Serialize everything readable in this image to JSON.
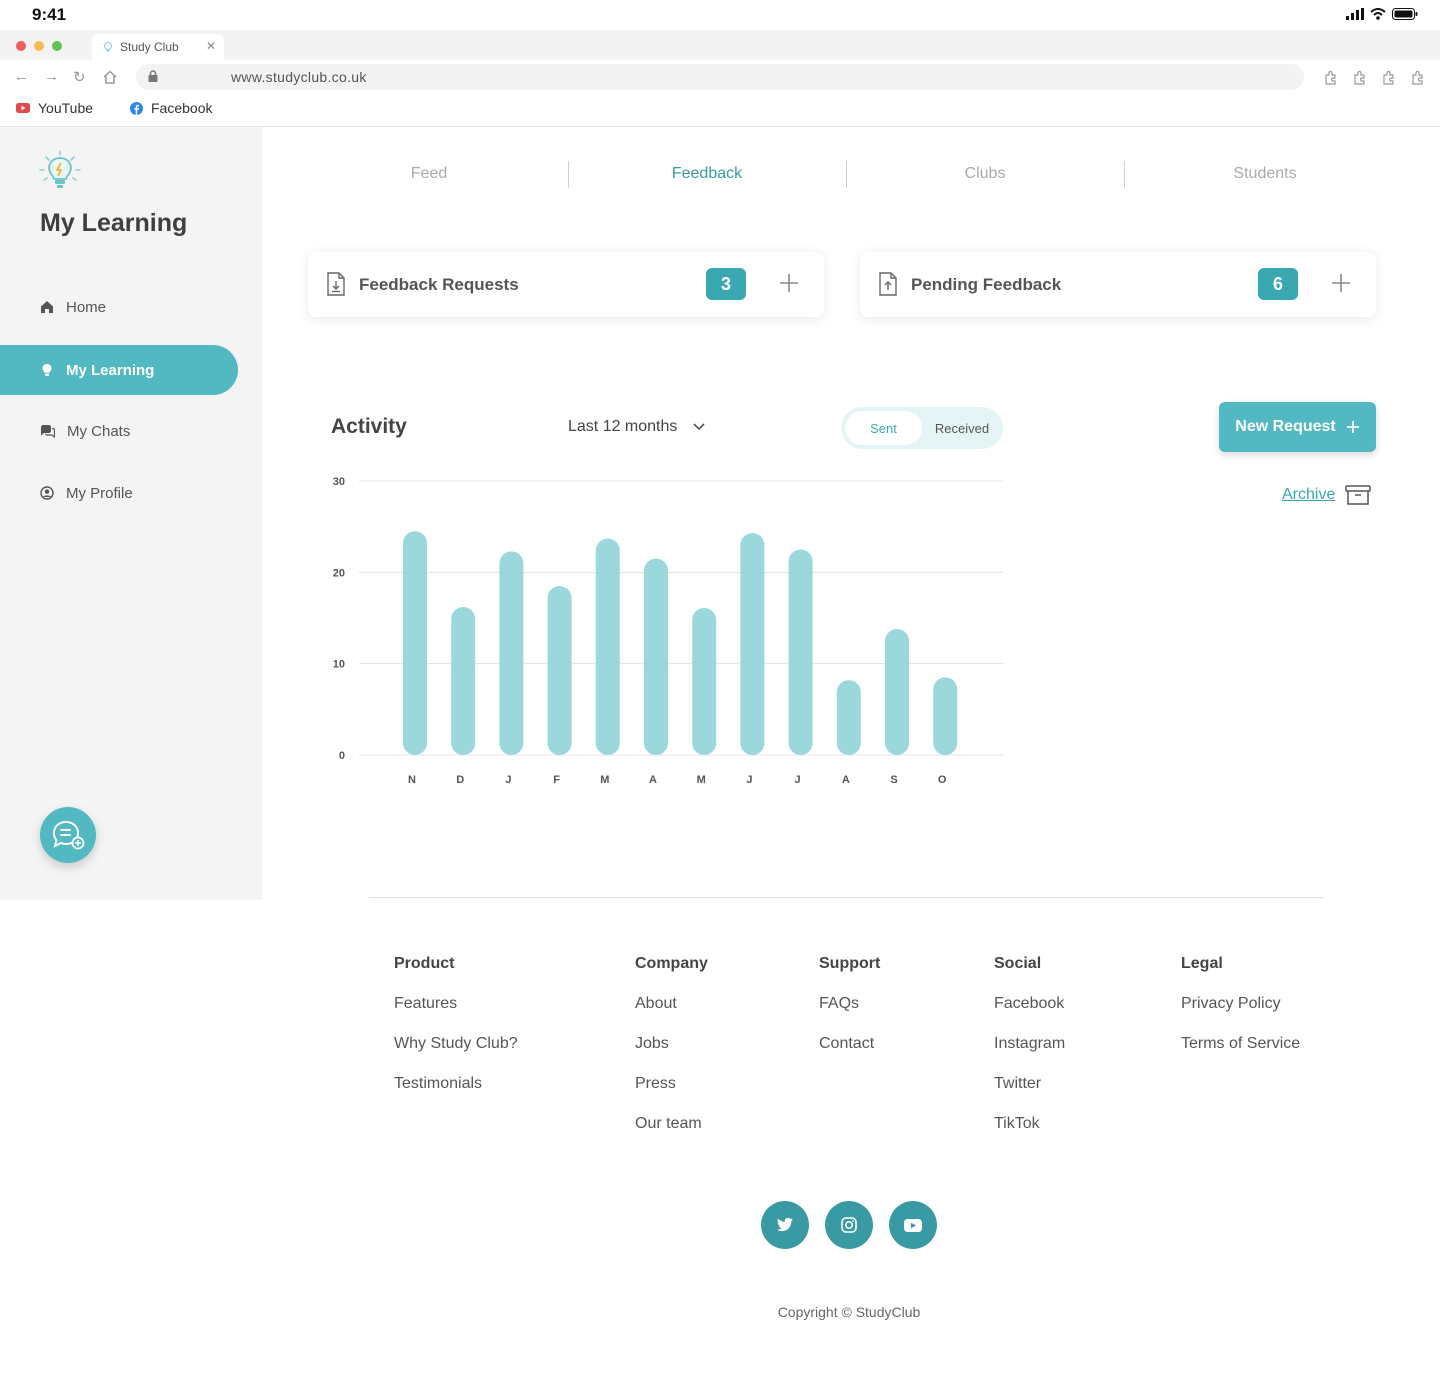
{
  "status_bar": {
    "time": "9:41"
  },
  "browser": {
    "tab_title": "Study Club",
    "url": "www.studyclub.co.uk",
    "bookmarks": [
      {
        "label": "YouTube",
        "icon": "youtube-icon"
      },
      {
        "label": "Facebook",
        "icon": "facebook-icon"
      }
    ]
  },
  "sidebar": {
    "title": "My Learning",
    "items": [
      {
        "label": "Home",
        "icon": "home-icon",
        "active": false
      },
      {
        "label": "My Learning",
        "icon": "lightbulb-icon",
        "active": true
      },
      {
        "label": "My Chats",
        "icon": "chat-icon",
        "active": false
      },
      {
        "label": "My Profile",
        "icon": "profile-icon",
        "active": false
      }
    ]
  },
  "top_tabs": [
    {
      "label": "Feed",
      "active": false
    },
    {
      "label": "Feedback",
      "active": true
    },
    {
      "label": "Clubs",
      "active": false
    },
    {
      "label": "Students",
      "active": false
    }
  ],
  "cards": [
    {
      "label": "Feedback Requests",
      "count": "3",
      "icon": "file-download-icon"
    },
    {
      "label": "Pending Feedback",
      "count": "6",
      "icon": "file-upload-icon"
    }
  ],
  "activity": {
    "title": "Activity",
    "range": "Last 12 months",
    "toggle": {
      "sent": "Sent",
      "received": "Received",
      "selected": "Sent"
    },
    "new_request_label": "New Request",
    "archive_label": "Archive"
  },
  "chart_data": {
    "type": "bar",
    "title": "",
    "xlabel": "",
    "ylabel": "",
    "categories": [
      "N",
      "D",
      "J",
      "F",
      "M",
      "A",
      "M",
      "J",
      "J",
      "A",
      "S",
      "O"
    ],
    "values": [
      24.5,
      16.2,
      22.3,
      18.5,
      23.7,
      21.5,
      16.1,
      24.3,
      22.5,
      8.2,
      13.8,
      8.5
    ],
    "ylim": [
      0,
      30
    ],
    "yticks": [
      0,
      10,
      20,
      30
    ],
    "grid": true,
    "color": "#9bd8dc"
  },
  "footer": {
    "columns": [
      {
        "heading": "Product",
        "links": [
          "Features",
          "Why Study Club?",
          "Testimonials"
        ]
      },
      {
        "heading": "Company",
        "links": [
          "About",
          "Jobs",
          "Press",
          "Our team"
        ]
      },
      {
        "heading": "Support",
        "links": [
          "FAQs",
          "Contact"
        ]
      },
      {
        "heading": "Social",
        "links": [
          "Facebook",
          "Instagram",
          "Twitter",
          "TikTok"
        ]
      },
      {
        "heading": "Legal",
        "links": [
          "Privacy Policy",
          "Terms of Service"
        ]
      }
    ],
    "social_icons": [
      "twitter-icon",
      "instagram-icon",
      "youtube-icon"
    ],
    "copyright": "Copyright © StudyClub"
  },
  "colors": {
    "accent": "#52b9c2",
    "accent_dark": "#3a9aa3",
    "bar": "#9bd8dc"
  }
}
